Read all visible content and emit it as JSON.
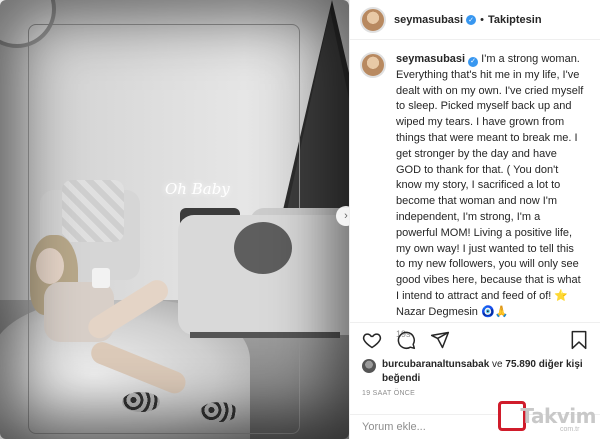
{
  "post": {
    "username": "seymasubasi",
    "follow_label": "Takiptesin",
    "separator": "•",
    "caption": "I'm a strong woman. Everything that's hit me in my life, I've dealt with on my own. I've cried myself to sleep. Picked myself back up and wiped my tears. I have grown from things that were meant to break me. I get stronger by the day and have GOD to thank for that. ( You don't know my story, I sacrificed a lot to become that woman and now I'm independent, I'm strong, I'm a powerful MOM! Living a positive life, my own way! I just wanted to tell this to my new followers, you will only see good vibes here, because that is what I intend to attract and feed of of! ⭐ Nazar Degmesin 🧿🙏",
    "caption_time": "19s",
    "neon_sign": "Oh Baby"
  },
  "likes": {
    "liker": "burcubaranaltunsabak",
    "connector": "ve",
    "others": "75.890 diğer kişi",
    "suffix": "beğendi"
  },
  "time_ago": "19 SAAT ÖNCE",
  "comment_input": {
    "placeholder": "Yorum ekle..."
  },
  "watermark": {
    "brand": "Takvim",
    "sub": "com.tr"
  },
  "icons": {
    "verified": "verified-badge-icon",
    "like": "heart-icon",
    "comment": "comment-bubble-icon",
    "share": "share-send-icon",
    "save": "bookmark-icon",
    "next": "chevron-right-icon"
  },
  "colors": {
    "verified_blue": "#3897f0",
    "text_primary": "#262626",
    "text_secondary": "#8e8e8e",
    "watermark_red": "#d01c2b"
  }
}
